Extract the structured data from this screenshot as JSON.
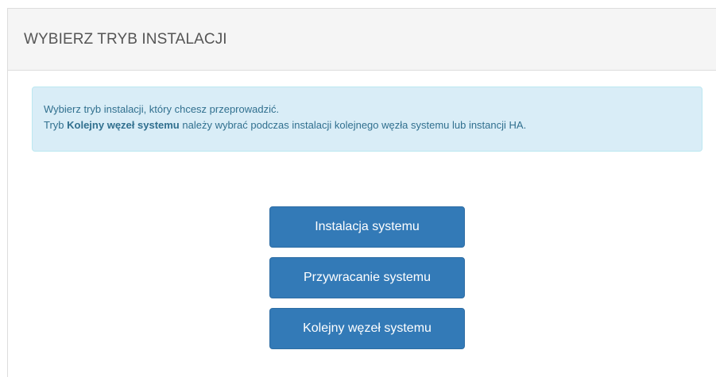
{
  "panel": {
    "title": "WYBIERZ TRYB INSTALACJI"
  },
  "info": {
    "line1": "Wybierz tryb instalacji, który chcesz przeprowadzić.",
    "line2_prefix": "Tryb ",
    "line2_bold": "Kolejny węzeł systemu",
    "line2_suffix": " należy wybrać podczas instalacji kolejnego węzła systemu lub instancji HA."
  },
  "buttons": {
    "install": "Instalacja systemu",
    "restore": "Przywracanie systemu",
    "next_node": "Kolejny węzeł systemu"
  },
  "colors": {
    "primary": "#337ab7",
    "info_bg": "#d9edf7",
    "info_text": "#31708f"
  }
}
